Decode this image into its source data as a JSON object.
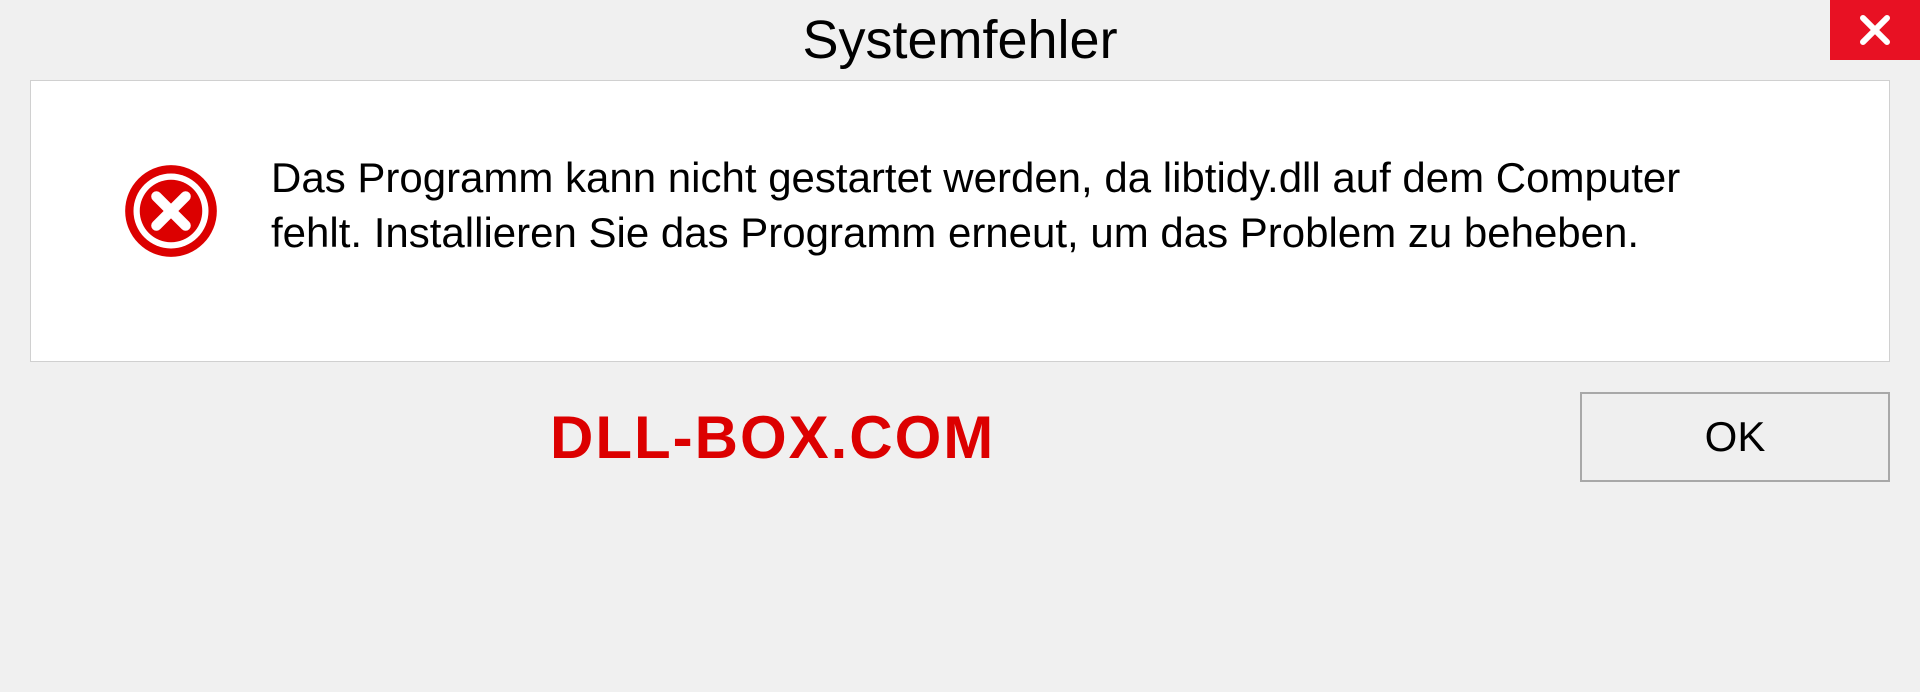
{
  "dialog": {
    "title": "Systemfehler",
    "message": "Das Programm kann nicht gestartet werden, da libtidy.dll auf dem Computer fehlt. Installieren Sie das Programm erneut, um das Problem zu beheben.",
    "ok_button": "OK"
  },
  "watermark": "DLL-BOX.COM",
  "colors": {
    "close_button": "#e81123",
    "error_icon": "#dc0000",
    "watermark": "#dc0000"
  }
}
